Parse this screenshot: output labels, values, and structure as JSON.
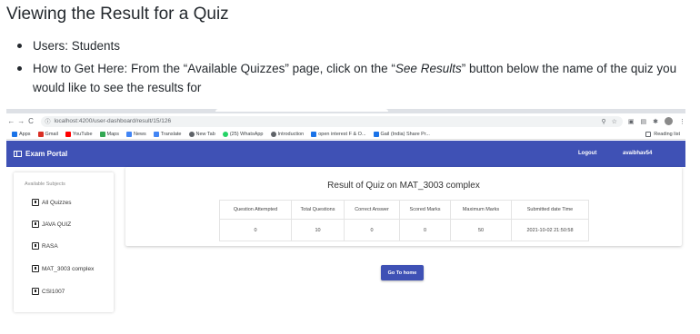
{
  "doc": {
    "title": "Viewing the Result for a Quiz",
    "bullets": [
      {
        "text": "Users: Students"
      },
      {
        "text_before": "How to Get Here: From the “Available Quizzes” page, click on the “",
        "emphasis": "See Results",
        "text_after": "” button below the name of the quiz you would like to see the results for"
      }
    ]
  },
  "browser": {
    "url": "localhost:4200/user-dashboard/result/15/126",
    "bookmarks": [
      {
        "label": "Apps",
        "color": "#1a73e8"
      },
      {
        "label": "Gmail",
        "color": "#d93025"
      },
      {
        "label": "YouTube",
        "color": "#ff0000"
      },
      {
        "label": "Maps",
        "color": "#34a853"
      },
      {
        "label": "News",
        "color": "#4285f4"
      },
      {
        "label": "Translate",
        "color": "#4285f4"
      },
      {
        "label": "New Tab",
        "color": "#5f6368"
      },
      {
        "label": "(25) WhatsApp",
        "color": "#25d366"
      },
      {
        "label": "Introduction",
        "color": "#5f6368"
      },
      {
        "label": "open interest F & O...",
        "color": "#1a73e8"
      },
      {
        "label": "Gail (India) Share Pr...",
        "color": "#1a73e8"
      }
    ],
    "reading_list": "Reading list"
  },
  "app": {
    "brand": "Exam Portal",
    "logout": "Logout",
    "username": "avaibhav54",
    "accent": "#3f51b5"
  },
  "sidebar": {
    "heading": "Available Subjects",
    "items": [
      {
        "label": "All Quizzes"
      },
      {
        "label": "JAVA QUIZ"
      },
      {
        "label": "RASA"
      },
      {
        "label": "MAT_3003 complex"
      },
      {
        "label": "CSI1007"
      }
    ]
  },
  "result": {
    "title": "Result of Quiz on MAT_3003 complex",
    "columns": [
      "Question Attempted",
      "Total Questions",
      "Correct Answer",
      "Scored Marks",
      "Maximum Marks",
      "Submitted date Time"
    ],
    "values": [
      "0",
      "10",
      "0",
      "0",
      "50",
      "2021-10-02 21:50:58"
    ]
  },
  "go_home": "Go To home"
}
